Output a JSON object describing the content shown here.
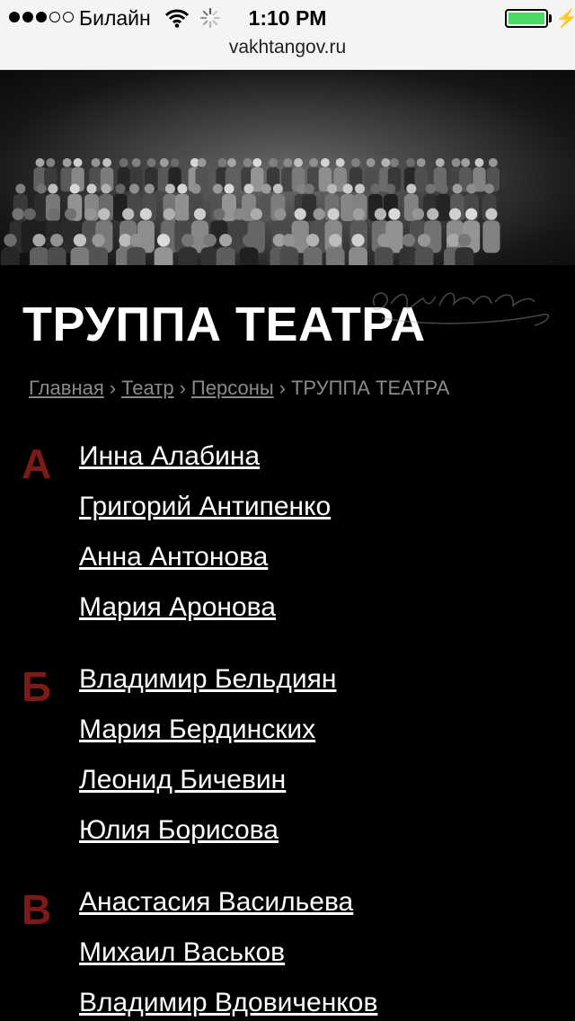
{
  "status_bar": {
    "carrier": "Билайн",
    "time": "1:10 PM",
    "battery_level": 1.0,
    "signal_bars_filled": 3,
    "signal_bars_total": 5
  },
  "browser": {
    "url": "vakhtangov.ru"
  },
  "page": {
    "title": "ТРУППА ТЕАТРА",
    "breadcrumb": {
      "items": [
        "Главная",
        "Театр",
        "Персоны"
      ],
      "current": "ТРУППА ТЕАТРА",
      "separator": "›"
    }
  },
  "groups": [
    {
      "letter": "А",
      "people": [
        "Инна Алабина",
        "Григорий Антипенко",
        "Анна Антонова",
        "Мария Аронова"
      ]
    },
    {
      "letter": "Б",
      "people": [
        "Владимир Бельдиян",
        "Мария Бердинских",
        "Леонид Бичевин",
        "Юлия Борисова"
      ]
    },
    {
      "letter": "В",
      "people": [
        "Анастасия Васильева",
        "Михаил Васьков",
        "Владимир Вдовиченков"
      ]
    }
  ],
  "colors": {
    "letter_accent": "#7d1a16",
    "background": "#000000",
    "battery_green": "#4cd964"
  }
}
